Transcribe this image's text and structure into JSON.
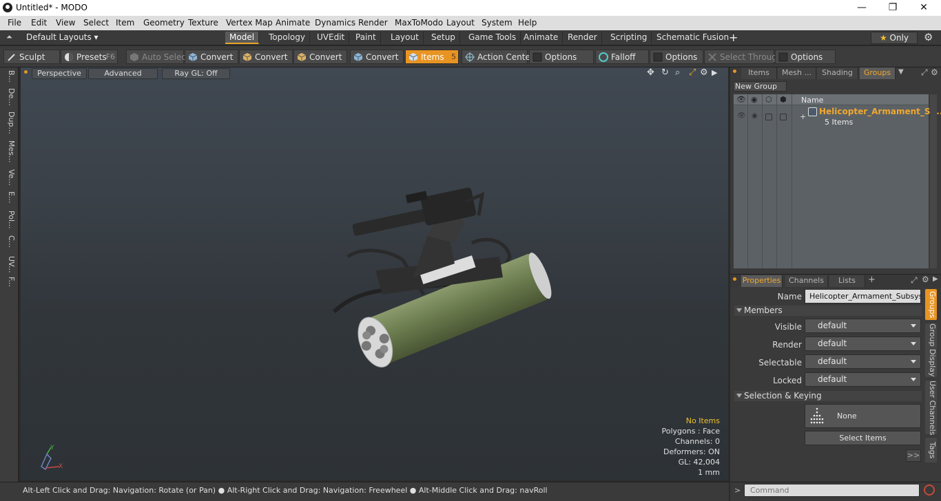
{
  "titlebar": {
    "title": "Untitled* - MODO",
    "minimize_glyph": "—",
    "restore_glyph": "❐",
    "close_glyph": "✕"
  },
  "menu": [
    "File",
    "Edit",
    "View",
    "Select",
    "Item",
    "Geometry",
    "Texture",
    "Vertex Map",
    "Animate",
    "Dynamics",
    "Render",
    "MaxToModo",
    "Layout",
    "System",
    "Help"
  ],
  "layoutbar": {
    "layouts_label": "Default Layouts",
    "tabs": [
      "Model",
      "Topology",
      "UVEdit",
      "Paint",
      "Layout",
      "Setup",
      "Game Tools",
      "Animate",
      "Render",
      "Scripting",
      "Schematic Fusion"
    ],
    "active_tab": "Model",
    "add_glyph": "+",
    "only_label": "Only"
  },
  "toolbar": {
    "sculpt": "Sculpt",
    "presets": "Presets",
    "presets_key": "F6",
    "auto_select": "Auto Select",
    "convert1": "Convert",
    "convert2": "Convert",
    "convert3": "Convert",
    "convert4": "Convert",
    "items": "Items",
    "items_key": "5",
    "action_center": "Action Center",
    "options1": "Options",
    "falloff": "Falloff",
    "options2": "Options",
    "select_through": "Select Through",
    "options3": "Options"
  },
  "lefttabs": [
    "B...",
    "De...",
    "Dup...",
    "Mes...",
    "Ve...",
    "E...",
    "Pol...",
    "C...",
    "UV...",
    "F..."
  ],
  "viewport": {
    "perspective": "Perspective",
    "advanced": "Advanced",
    "raygl": "Ray GL: Off",
    "info": {
      "items": "No Items",
      "polygons": "Polygons : Face",
      "channels": "Channels: 0",
      "deformers": "Deformers: ON",
      "gl": "GL: 42,004",
      "unit": "1 mm"
    },
    "axis_y": "Y",
    "axis_x": "X"
  },
  "statusbar": {
    "text": "Alt-Left Click and Drag: Navigation: Rotate (or Pan) ● Alt-Right Click and Drag: Navigation: Freewheel ● Alt-Middle Click and Drag: navRoll"
  },
  "itempanel": {
    "tabs": [
      "Items",
      "Mesh ...",
      "Shading",
      "Groups"
    ],
    "active_tab": "Groups",
    "new_group": "New Group",
    "col_name": "Name",
    "group_name": "Helicopter_Armament_S ...",
    "group_count": "5 Items",
    "expand_glyph": "+"
  },
  "properties": {
    "tabs": [
      "Properties",
      "Channels",
      "Lists"
    ],
    "active_tab": "Properties",
    "add_glyph": "+",
    "name_label": "Name",
    "name_value": "Helicopter_Armament_Subsystem",
    "members_header": "Members",
    "visible_label": "Visible",
    "visible_value": "default",
    "render_label": "Render",
    "render_value": "default",
    "selectable_label": "Selectable",
    "selectable_value": "default",
    "locked_label": "Locked",
    "locked_value": "default",
    "selkey_header": "Selection & Keying",
    "none_label": "None",
    "select_items": "Select Items",
    "more_glyph": ">>",
    "side_tabs": [
      "Groups",
      "Group Display",
      "User Channels",
      "Tags"
    ]
  },
  "command": {
    "prompt_glyph": ">",
    "placeholder": "Command"
  },
  "colors": {
    "accent": "#e89423",
    "group_name": "#f0a830",
    "items_selected": "#e89423"
  }
}
